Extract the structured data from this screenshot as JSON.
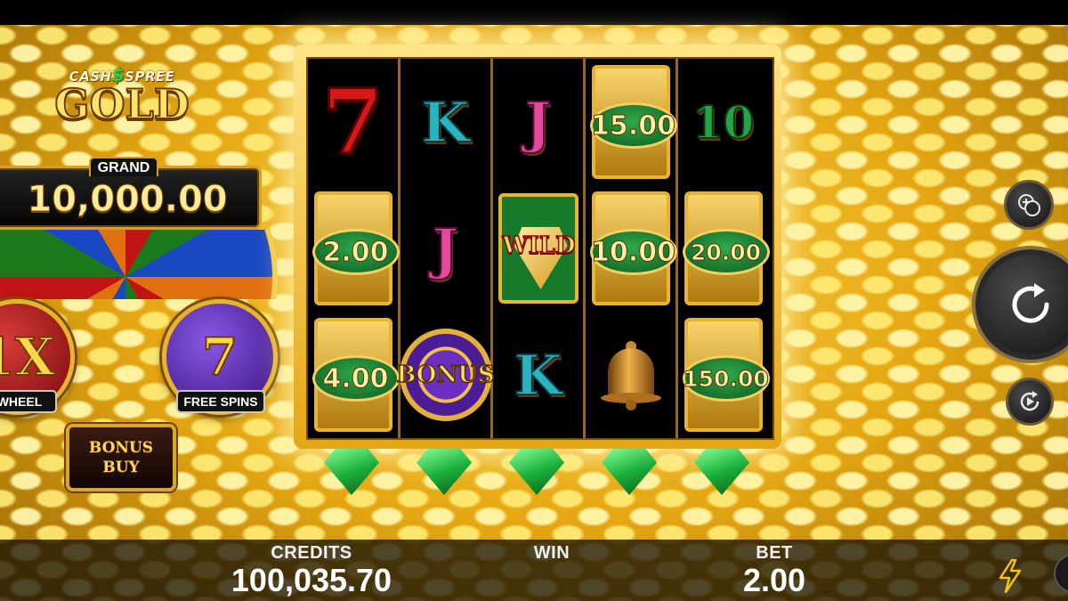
{
  "logo": {
    "line1_left": "CASH",
    "line1_symbol": "$",
    "line1_right": "SPREE",
    "main": "GOLD"
  },
  "jackpot": {
    "label": "GRAND",
    "value": "10,000.00"
  },
  "features": {
    "wheel": {
      "symbol": "1X",
      "label": "WHEEL"
    },
    "free_spins": {
      "symbol": "7",
      "label": "FREE SPINS"
    }
  },
  "bonus_buy": {
    "line1": "BONUS",
    "line2": "BUY"
  },
  "reels": {
    "col1": {
      "r1": "7",
      "r2": "2.00",
      "r3": "4.00"
    },
    "col2": {
      "r1": "K",
      "r2": "J",
      "r3": "BONUS"
    },
    "col3": {
      "r1": "J",
      "r2": "WILD",
      "r3": "K"
    },
    "col4": {
      "r1": "15.00",
      "r2": "10.00",
      "r3": "bell-icon"
    },
    "col5": {
      "r1": "10",
      "r2": "20.00",
      "r3": "150.00"
    }
  },
  "meters": {
    "credits": {
      "label": "CREDITS",
      "value": "100,035.70"
    },
    "win": {
      "label": "WIN",
      "value": ""
    },
    "bet": {
      "label": "BET",
      "value": "2.00"
    }
  },
  "icons": {
    "bet_settings": "coins-settings-icon",
    "spin": "spin-icon",
    "autoplay": "autoplay-icon",
    "turbo": "lightning-icon"
  },
  "colors": {
    "gold": "#e4a612",
    "cash_green": "#167a2a",
    "gem_green": "#1bb03a"
  }
}
